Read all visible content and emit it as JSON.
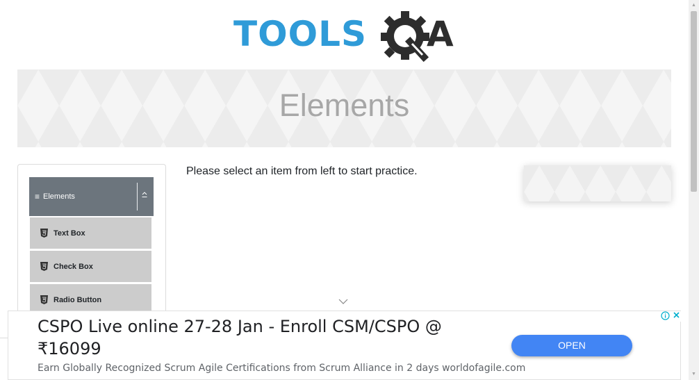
{
  "logo": {
    "text": "TOOLS",
    "suffix": "A"
  },
  "banner": {
    "title": "Elements"
  },
  "sidebar": {
    "group_title": "Elements",
    "items": [
      {
        "label": "Text Box",
        "icon": "html5-icon"
      },
      {
        "label": "Check Box",
        "icon": "html5-icon"
      },
      {
        "label": "Radio Button",
        "icon": "html5-icon"
      }
    ]
  },
  "main": {
    "prompt": "Please select an item from left to start practice."
  },
  "ad": {
    "title": "CSPO Live online 27-28 Jan - Enroll CSM/CSPO @ ₹16099",
    "description": "Earn Globally Recognized Scrum Agile Certifications from Scrum Alliance in 2 days worldofagile.com",
    "button": "OPEN"
  },
  "colors": {
    "logo_blue": "#2f9bd8",
    "logo_dark": "#2d2d2d",
    "header_gray": "#6c757d",
    "menu_item_gray": "#cccccc",
    "ad_button_blue": "#4285f4"
  }
}
